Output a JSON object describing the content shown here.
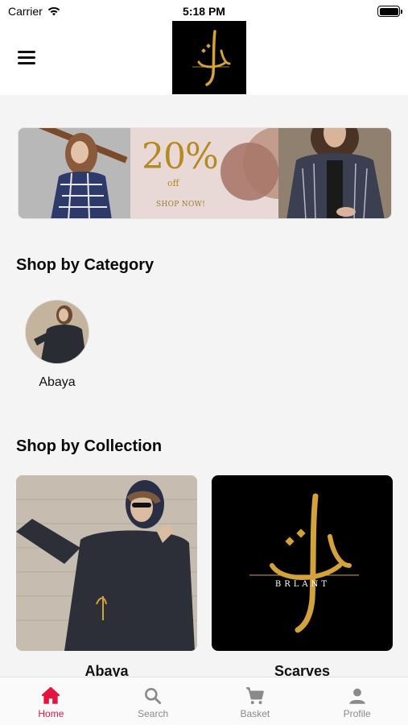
{
  "status_bar": {
    "carrier": "Carrier",
    "time": "5:18 PM"
  },
  "header": {
    "menu_icon": "hamburger-icon",
    "logo": "brlant-logo"
  },
  "banner": {
    "percent": "20%",
    "off": "off",
    "cta": "SHOP NOW!"
  },
  "sections": {
    "category_title": "Shop by Category",
    "collection_title": "Shop by Collection"
  },
  "categories": [
    {
      "label": "Abaya"
    }
  ],
  "collections": [
    {
      "label": "Abaya"
    },
    {
      "label": "Scarves"
    }
  ],
  "logo_text": "BRLANT",
  "bottom_nav": [
    {
      "label": "Home",
      "icon": "home-icon",
      "active": true
    },
    {
      "label": "Search",
      "icon": "search-icon",
      "active": false
    },
    {
      "label": "Basket",
      "icon": "cart-icon",
      "active": false
    },
    {
      "label": "Profile",
      "icon": "person-icon",
      "active": false
    }
  ],
  "colors": {
    "accent": "#e3143d",
    "gold": "#d4a23a",
    "inactive": "#8a8a8a"
  }
}
